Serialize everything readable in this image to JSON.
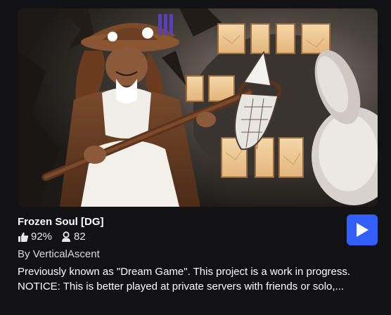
{
  "game": {
    "title": "Frozen Soul [DG]",
    "creator_prefix": "By ",
    "creator_name": "VerticalAscent",
    "description_line1": "Previously known as \"Dream Game\". This project is a work in progress.",
    "description_line2": "NOTICE: This is better played at private servers with friends or solo,..."
  },
  "stats": {
    "like_ratio": "92%",
    "player_count": "82"
  },
  "icons": {
    "thumbs_up": "thumbs-up-icon",
    "players": "person-icon",
    "play": "play-icon"
  },
  "colors": {
    "background": "#121215",
    "play_button": "#335fff",
    "text": "#ffffff"
  }
}
